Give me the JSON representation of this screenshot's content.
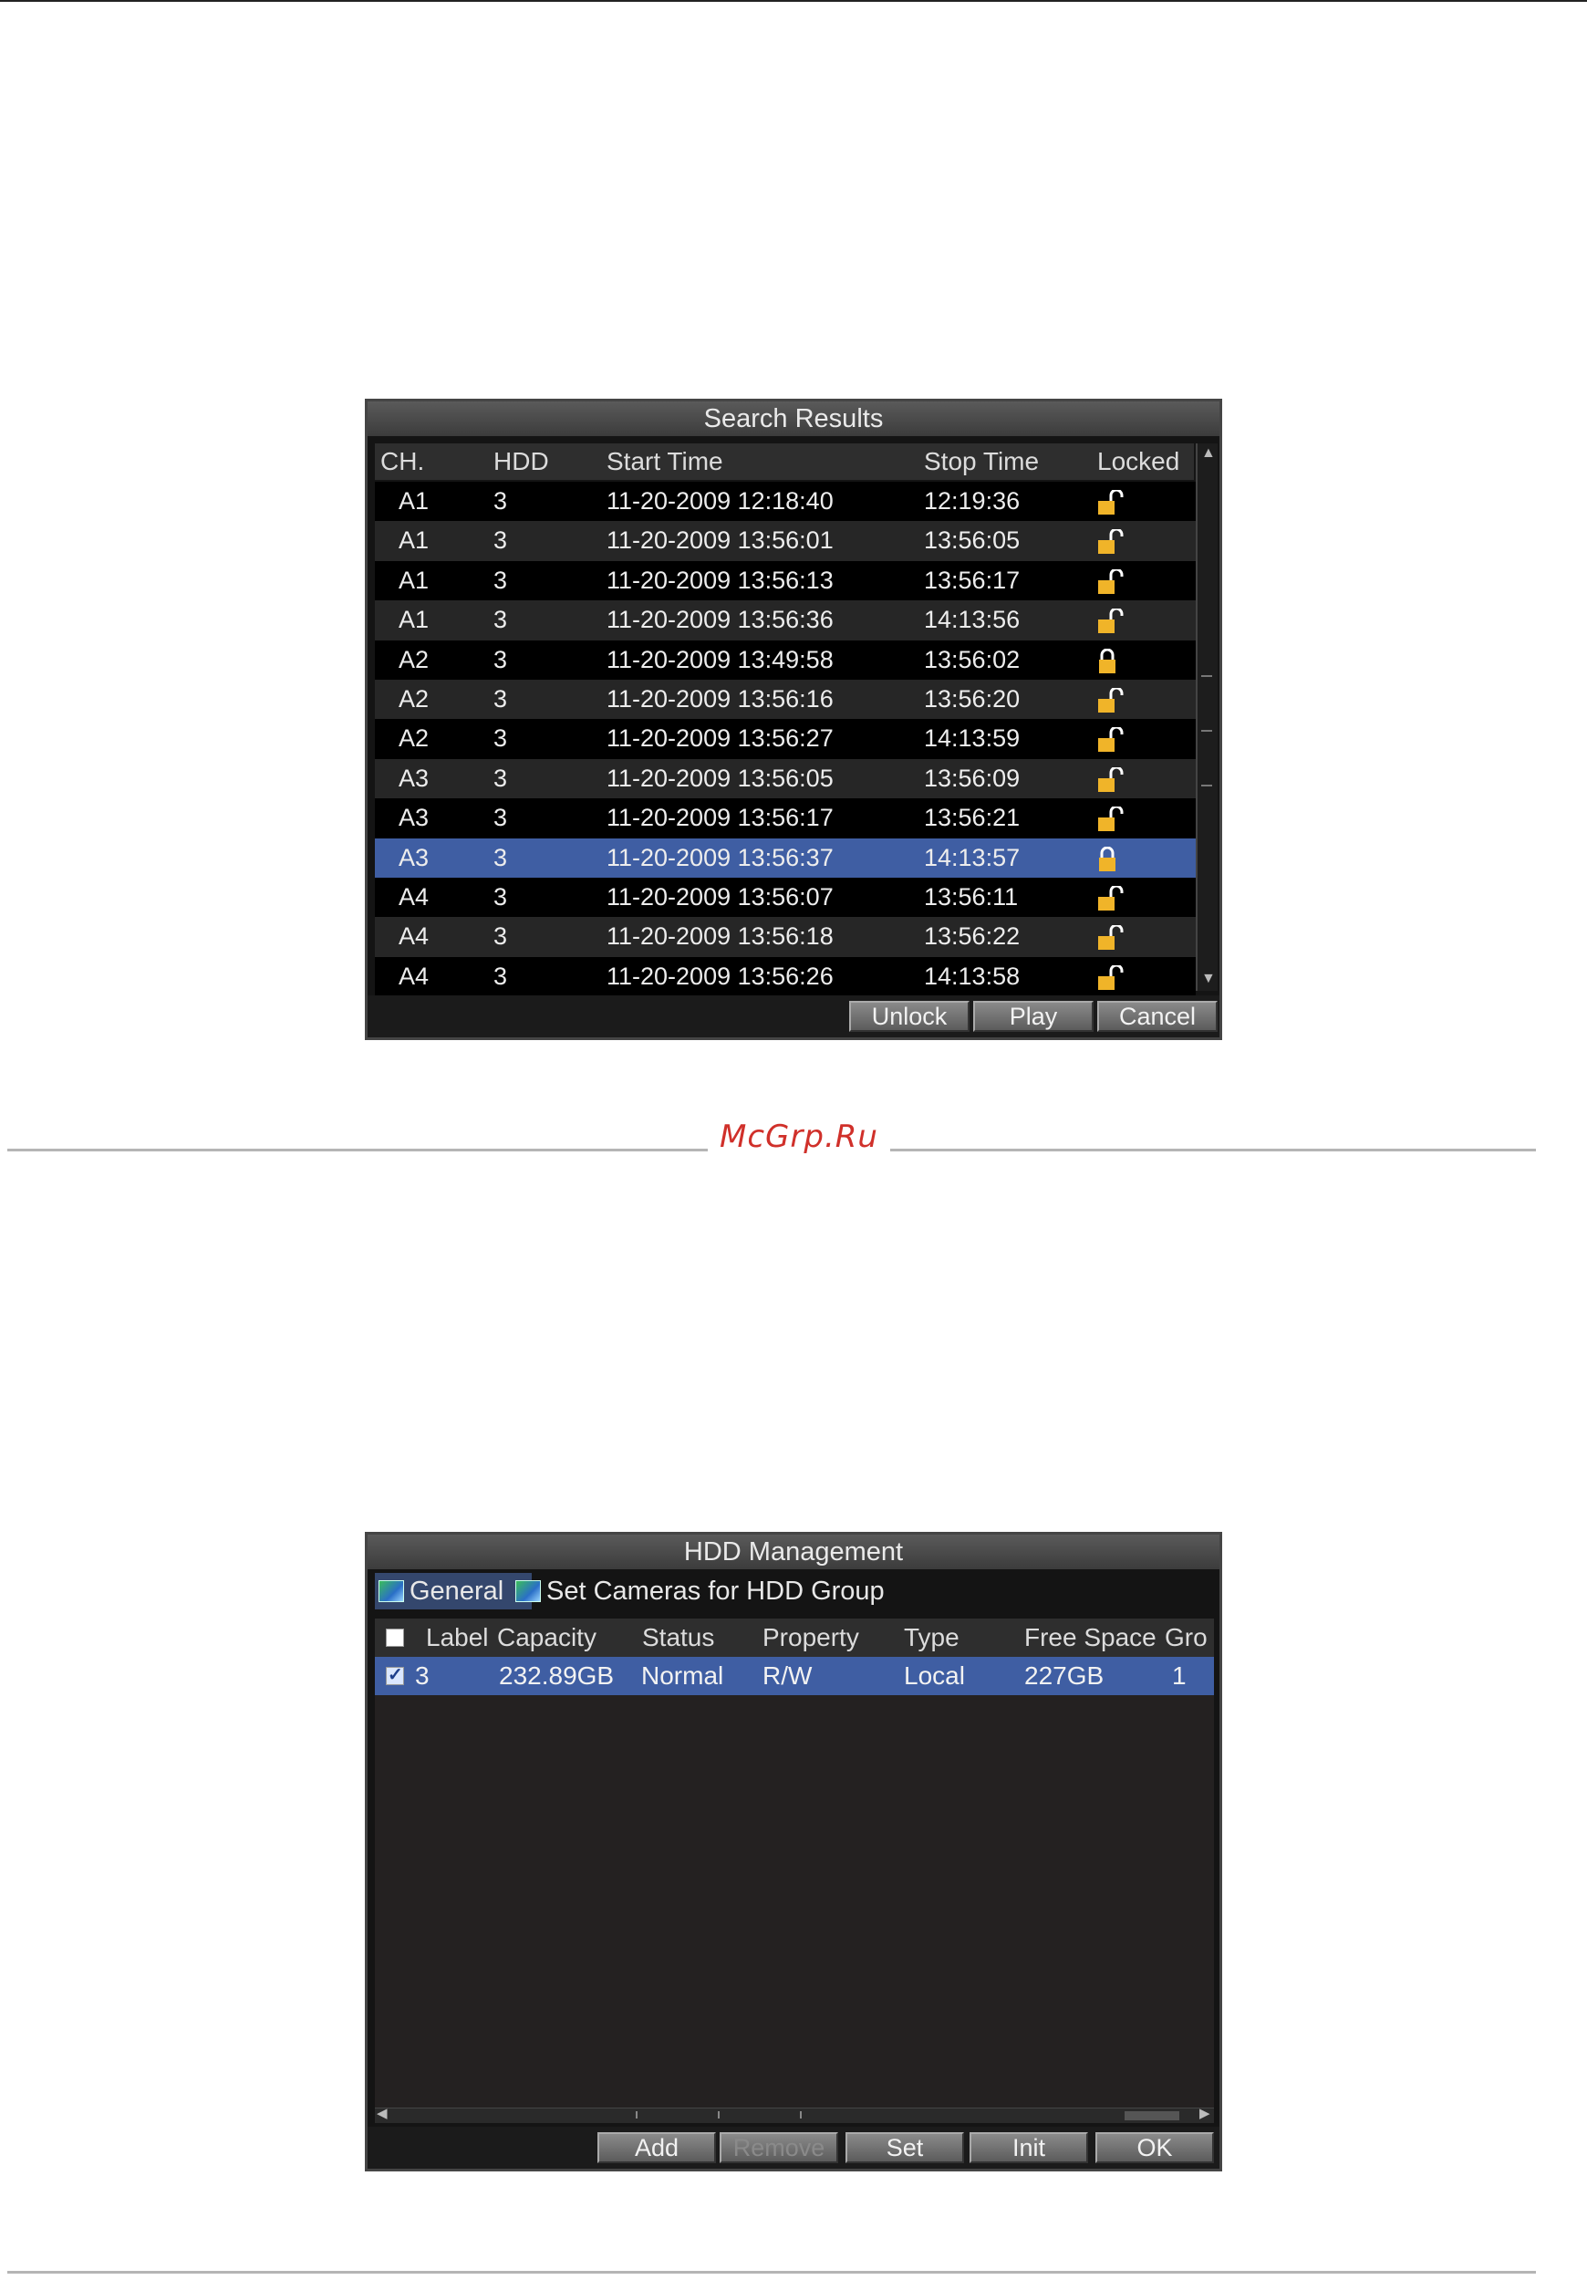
{
  "watermark": "McGrp.Ru",
  "search_results": {
    "title": "Search Results",
    "columns": {
      "ch": "CH.",
      "hdd": "HDD",
      "start": "Start Time",
      "stop": "Stop Time",
      "locked": "Locked"
    },
    "rows": [
      {
        "ch": "A1",
        "hdd": "3",
        "start": "11-20-2009 12:18:40",
        "stop": "12:19:36",
        "locked": false
      },
      {
        "ch": "A1",
        "hdd": "3",
        "start": "11-20-2009 13:56:01",
        "stop": "13:56:05",
        "locked": false
      },
      {
        "ch": "A1",
        "hdd": "3",
        "start": "11-20-2009 13:56:13",
        "stop": "13:56:17",
        "locked": false
      },
      {
        "ch": "A1",
        "hdd": "3",
        "start": "11-20-2009 13:56:36",
        "stop": "14:13:56",
        "locked": false
      },
      {
        "ch": "A2",
        "hdd": "3",
        "start": "11-20-2009 13:49:58",
        "stop": "13:56:02",
        "locked": true
      },
      {
        "ch": "A2",
        "hdd": "3",
        "start": "11-20-2009 13:56:16",
        "stop": "13:56:20",
        "locked": false
      },
      {
        "ch": "A2",
        "hdd": "3",
        "start": "11-20-2009 13:56:27",
        "stop": "14:13:59",
        "locked": false
      },
      {
        "ch": "A3",
        "hdd": "3",
        "start": "11-20-2009 13:56:05",
        "stop": "13:56:09",
        "locked": false
      },
      {
        "ch": "A3",
        "hdd": "3",
        "start": "11-20-2009 13:56:17",
        "stop": "13:56:21",
        "locked": false
      },
      {
        "ch": "A3",
        "hdd": "3",
        "start": "11-20-2009 13:56:37",
        "stop": "14:13:57",
        "locked": true,
        "selected": true
      },
      {
        "ch": "A4",
        "hdd": "3",
        "start": "11-20-2009 13:56:07",
        "stop": "13:56:11",
        "locked": false
      },
      {
        "ch": "A4",
        "hdd": "3",
        "start": "11-20-2009 13:56:18",
        "stop": "13:56:22",
        "locked": false
      },
      {
        "ch": "A4",
        "hdd": "3",
        "start": "11-20-2009 13:56:26",
        "stop": "14:13:58",
        "locked": false
      }
    ],
    "buttons": {
      "unlock": "Unlock",
      "play": "Play",
      "cancel": "Cancel"
    },
    "selected_row_color": "#3f5ea3",
    "lock_icon_color": "#f0b429"
  },
  "hdd_management": {
    "title": "HDD Management",
    "tabs": {
      "general": "General",
      "set_cameras": "Set Cameras for HDD Group"
    },
    "columns": {
      "label": "Label",
      "capacity": "Capacity",
      "status": "Status",
      "property": "Property",
      "type": "Type",
      "free_space": "Free Space",
      "group": "Gro"
    },
    "disk": {
      "label": "3",
      "capacity": "232.89GB",
      "status": "Normal",
      "property": "R/W",
      "type": "Local",
      "free_space": "227GB",
      "group": "1",
      "checked": true
    },
    "buttons": {
      "add": "Add",
      "remove": "Remove",
      "set": "Set",
      "init": "Init",
      "ok": "OK"
    },
    "remove_disabled": true
  }
}
